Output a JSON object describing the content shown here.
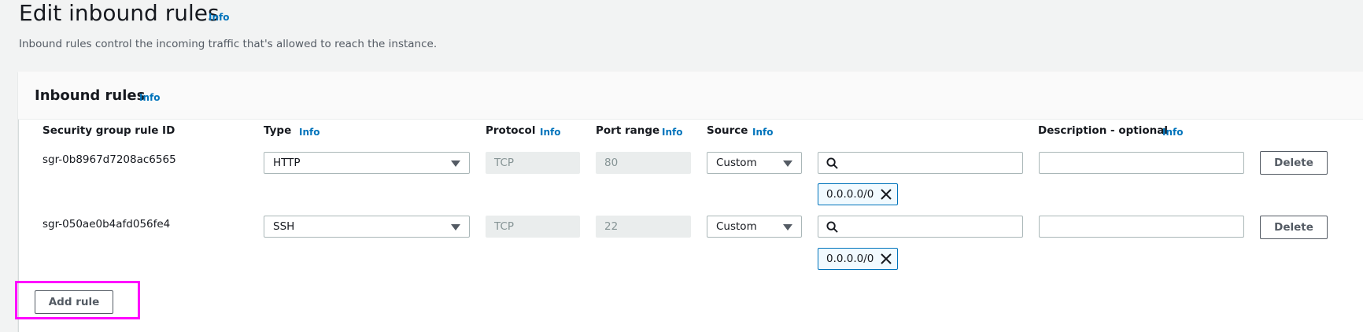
{
  "page": {
    "title": "Edit inbound rules",
    "title_info": "Info",
    "subtitle": "Inbound rules control the incoming traffic that's allowed to reach the instance."
  },
  "panel": {
    "title": "Inbound rules",
    "info": "Info",
    "columns": {
      "rule_id": "Security group rule ID",
      "type": "Type",
      "protocol": "Protocol",
      "port_range": "Port range",
      "source": "Source",
      "description": "Description - optional",
      "info": "Info"
    },
    "rows": [
      {
        "rule_id": "sgr-0b8967d7208ac6565",
        "type": "HTTP",
        "protocol": "TCP",
        "port_range": "80",
        "source": "Custom",
        "source_search_value": "",
        "token": "0.0.0.0/0",
        "description": "",
        "delete_label": "Delete"
      },
      {
        "rule_id": "sgr-050ae0b4afd056fe4",
        "type": "SSH",
        "protocol": "TCP",
        "port_range": "22",
        "source": "Custom",
        "source_search_value": "",
        "token": "0.0.0.0/0",
        "description": "",
        "delete_label": "Delete"
      }
    ],
    "add_rule_label": "Add rule"
  },
  "colors": {
    "link": "#0073bb",
    "highlight": "#ff00ff",
    "token_border": "#0073bb"
  },
  "icons": {
    "search": "search-icon",
    "remove": "close-icon",
    "dropdown": "caret-down-icon"
  }
}
